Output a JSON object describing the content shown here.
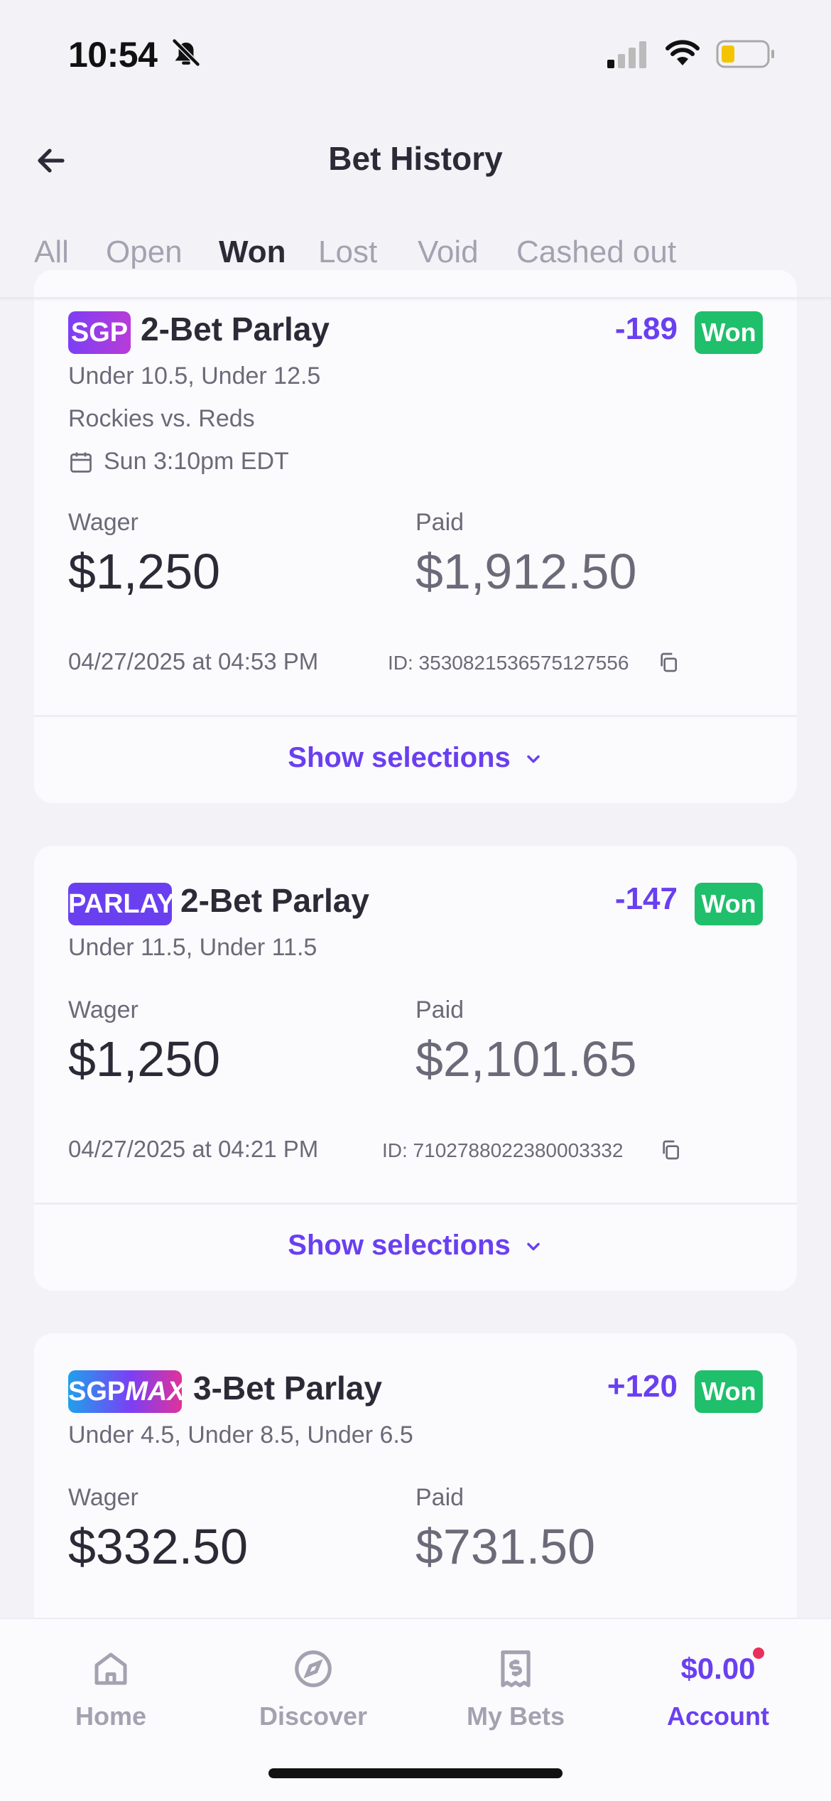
{
  "status": {
    "time": "10:54"
  },
  "header": {
    "title": "Bet History"
  },
  "tabs": [
    "All",
    "Open",
    "Won",
    "Lost",
    "Void",
    "Cashed out"
  ],
  "active_tab": "Won",
  "bets": [
    {
      "tag": "SGP",
      "title": "2-Bet Parlay",
      "odds": "-189",
      "status": "Won",
      "legs": "Under 10.5, Under 12.5",
      "matchup": "Rockies vs. Reds",
      "event_time": "Sun 3:10pm EDT",
      "wager_label": "Wager",
      "wager": "$1,250",
      "paid_label": "Paid",
      "paid": "$1,912.50",
      "placed": "04/27/2025 at 04:53 PM",
      "bet_id": "ID: 3530821536575127556",
      "show_selections": "Show selections"
    },
    {
      "tag": "PARLAY",
      "title": "2-Bet Parlay",
      "odds": "-147",
      "status": "Won",
      "legs": "Under 11.5, Under 11.5",
      "wager_label": "Wager",
      "wager": "$1,250",
      "paid_label": "Paid",
      "paid": "$2,101.65",
      "placed": "04/27/2025 at 04:21 PM",
      "bet_id": "ID: 7102788022380003332",
      "show_selections": "Show selections"
    },
    {
      "tag_a": "SGP",
      "tag_b": "MAX",
      "title": "3-Bet Parlay",
      "odds": "+120",
      "status": "Won",
      "legs": "Under 4.5, Under 8.5, Under 6.5",
      "wager_label": "Wager",
      "wager": "$332.50",
      "paid_label": "Paid",
      "paid": "$731.50"
    }
  ],
  "nav": {
    "home": "Home",
    "discover": "Discover",
    "my_bets": "My Bets",
    "balance": "$0.00",
    "account": "Account"
  },
  "colors": {
    "accent": "#6a3ff0",
    "won": "#1fbf6b",
    "notification_dot": "#e8305a"
  },
  "icons": [
    "bell-slash-icon",
    "signal-icon",
    "wifi-icon",
    "battery-icon",
    "back-arrow-icon",
    "calendar-icon",
    "copy-icon",
    "chevron-down-icon",
    "home-icon",
    "compass-icon",
    "ticket-icon"
  ]
}
